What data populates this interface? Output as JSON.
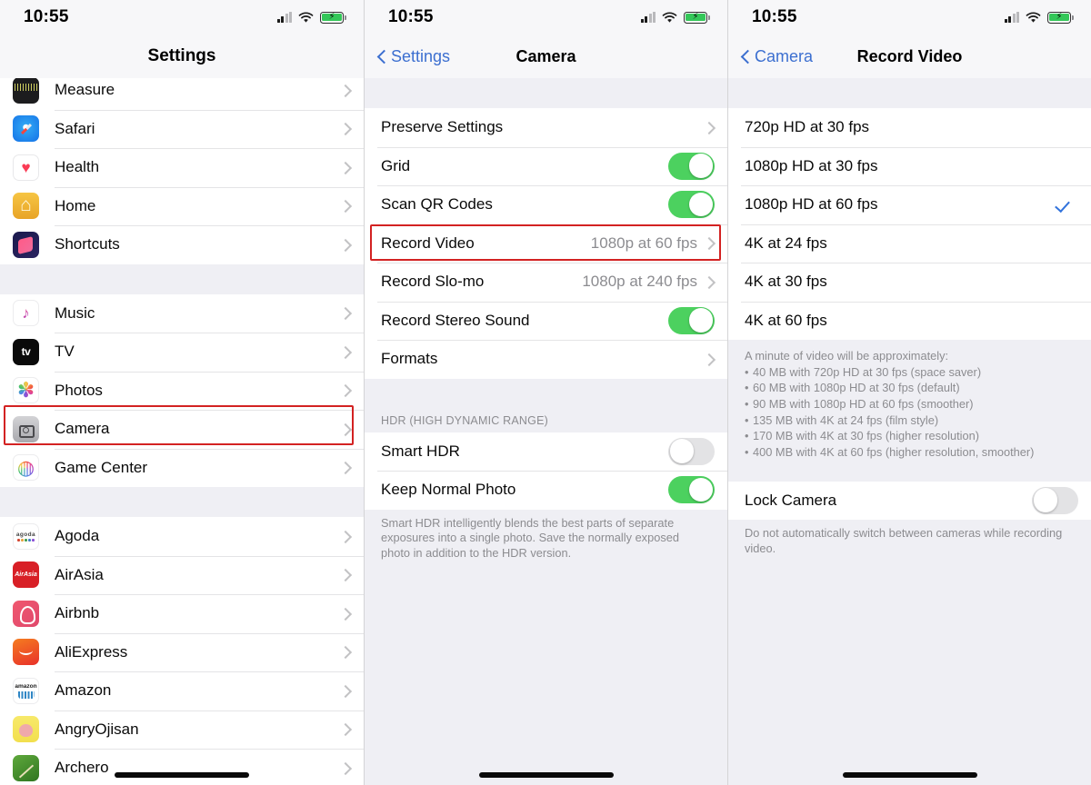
{
  "status_bar": {
    "time": "10:55",
    "signal_icon": "cellular-signal-icon",
    "wifi_icon": "wifi-icon",
    "battery_icon": "battery-charging-icon"
  },
  "screens": {
    "settings": {
      "nav": {
        "title": "Settings"
      },
      "groups": [
        {
          "rows": [
            {
              "icon": "measure-app-icon",
              "icon_class": "ic-measure",
              "label": "Measure",
              "accessory": "chevron"
            },
            {
              "icon": "safari-app-icon",
              "icon_class": "ic-safari",
              "label": "Safari",
              "accessory": "chevron"
            },
            {
              "icon": "health-app-icon",
              "icon_class": "ic-health",
              "label": "Health",
              "accessory": "chevron"
            },
            {
              "icon": "home-app-icon",
              "icon_class": "ic-home",
              "label": "Home",
              "accessory": "chevron"
            },
            {
              "icon": "shortcuts-app-icon",
              "icon_class": "ic-shortcuts",
              "label": "Shortcuts",
              "accessory": "chevron"
            }
          ]
        },
        {
          "rows": [
            {
              "icon": "music-app-icon",
              "icon_class": "ic-music",
              "label": "Music",
              "accessory": "chevron"
            },
            {
              "icon": "tv-app-icon",
              "icon_class": "ic-tv",
              "label": "TV",
              "accessory": "chevron"
            },
            {
              "icon": "photos-app-icon",
              "icon_class": "ic-photos",
              "label": "Photos",
              "accessory": "chevron"
            },
            {
              "icon": "camera-app-icon",
              "icon_class": "ic-camera",
              "label": "Camera",
              "accessory": "chevron",
              "highlighted": true
            },
            {
              "icon": "game-center-app-icon",
              "icon_class": "ic-gamecenter",
              "label": "Game Center",
              "accessory": "chevron"
            }
          ]
        },
        {
          "rows": [
            {
              "icon": "agoda-app-icon",
              "icon_class": "ic-agoda",
              "label": "Agoda",
              "accessory": "chevron"
            },
            {
              "icon": "airasia-app-icon",
              "icon_class": "ic-airasia",
              "label": "AirAsia",
              "accessory": "chevron"
            },
            {
              "icon": "airbnb-app-icon",
              "icon_class": "ic-airbnb",
              "label": "Airbnb",
              "accessory": "chevron"
            },
            {
              "icon": "aliexpress-app-icon",
              "icon_class": "ic-ali",
              "label": "AliExpress",
              "accessory": "chevron"
            },
            {
              "icon": "amazon-app-icon",
              "icon_class": "ic-amazon",
              "label": "Amazon",
              "accessory": "chevron"
            },
            {
              "icon": "angryojisan-app-icon",
              "icon_class": "ic-angry",
              "label": "AngryOjisan",
              "accessory": "chevron"
            },
            {
              "icon": "archero-app-icon",
              "icon_class": "ic-archero",
              "label": "Archero",
              "accessory": "chevron"
            }
          ]
        }
      ]
    },
    "camera": {
      "nav": {
        "back_label": "Settings",
        "title": "Camera"
      },
      "rows_group_1": [
        {
          "label": "Preserve Settings",
          "accessory": "chevron"
        },
        {
          "label": "Grid",
          "accessory": "toggle",
          "toggle_on": true
        },
        {
          "label": "Scan QR Codes",
          "accessory": "toggle",
          "toggle_on": true
        },
        {
          "label": "Record Video",
          "value": "1080p at 60 fps",
          "accessory": "chevron",
          "highlighted": true
        },
        {
          "label": "Record Slo-mo",
          "value": "1080p at 240 fps",
          "accessory": "chevron"
        },
        {
          "label": "Record Stereo Sound",
          "accessory": "toggle",
          "toggle_on": true
        },
        {
          "label": "Formats",
          "accessory": "chevron"
        }
      ],
      "section_hdr": "HDR (HIGH DYNAMIC RANGE)",
      "rows_group_2": [
        {
          "label": "Smart HDR",
          "accessory": "toggle",
          "toggle_on": false
        },
        {
          "label": "Keep Normal Photo",
          "accessory": "toggle",
          "toggle_on": true
        }
      ],
      "footnote": "Smart HDR intelligently blends the best parts of separate exposures into a single photo. Save the normally exposed photo in addition to the HDR version."
    },
    "record_video": {
      "nav": {
        "back_label": "Camera",
        "title": "Record Video"
      },
      "options": [
        {
          "label": "720p HD at 30 fps",
          "selected": false
        },
        {
          "label": "1080p HD at 30 fps",
          "selected": false
        },
        {
          "label": "1080p HD at 60 fps",
          "selected": true
        },
        {
          "label": "4K at 24 fps",
          "selected": false
        },
        {
          "label": "4K at 30 fps",
          "selected": false
        },
        {
          "label": "4K at 60 fps",
          "selected": false
        }
      ],
      "footnote_title": "A minute of video will be approximately:",
      "footnote_items": [
        "40 MB with 720p HD at 30 fps (space saver)",
        "60 MB with 1080p HD at 30 fps (default)",
        "90 MB with 1080p HD at 60 fps (smoother)",
        "135 MB with 4K at 24 fps (film style)",
        "170 MB with 4K at 30 fps (higher resolution)",
        "400 MB with 4K at 60 fps (higher resolution, smoother)"
      ],
      "lock_camera": {
        "label": "Lock Camera",
        "toggle_on": false
      },
      "lock_footnote": "Do not automatically switch between cameras while recording video."
    }
  },
  "colors": {
    "accent_blue": "#3c6fd0",
    "toggle_green": "#4cd15f",
    "highlight_red": "#d32222",
    "group_bg": "#efeff4",
    "secondary_text": "#8c8c90"
  }
}
